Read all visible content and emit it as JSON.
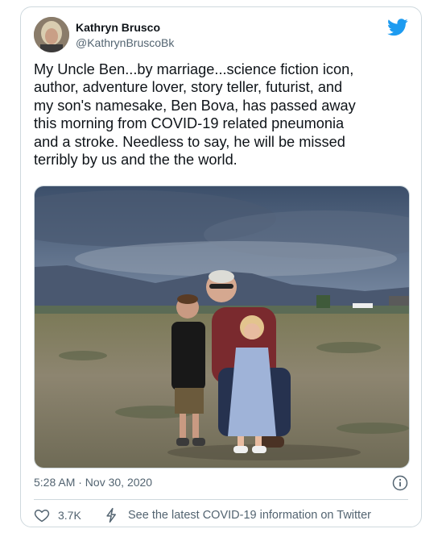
{
  "author": {
    "name": "Kathryn Brusco",
    "handle": "@KathrynBruscoBk"
  },
  "tweet": {
    "text": "My Uncle Ben...by marriage...science fiction icon,\nauthor, adventure lover, story teller, futurist, and\nmy son's namesake, Ben Bova, has passed away\nthis morning from COVID-19 related pneumonia\nand a stroke. Needless to say, he will be missed\nterribly by us and the the world.",
    "timestamp": "5:28 AM · Nov 30, 2020"
  },
  "actions": {
    "like_count": "3.7K",
    "covid_info": "See the latest COVID-19 information on Twitter"
  },
  "icons": {
    "brand": "twitter-bird-icon",
    "info": "info-icon",
    "like": "heart-icon",
    "covid": "lightning-icon"
  },
  "colors": {
    "brand_blue": "#1d9bf0",
    "text_primary": "#0f1419",
    "text_secondary": "#536471",
    "border": "#cfd9de"
  }
}
